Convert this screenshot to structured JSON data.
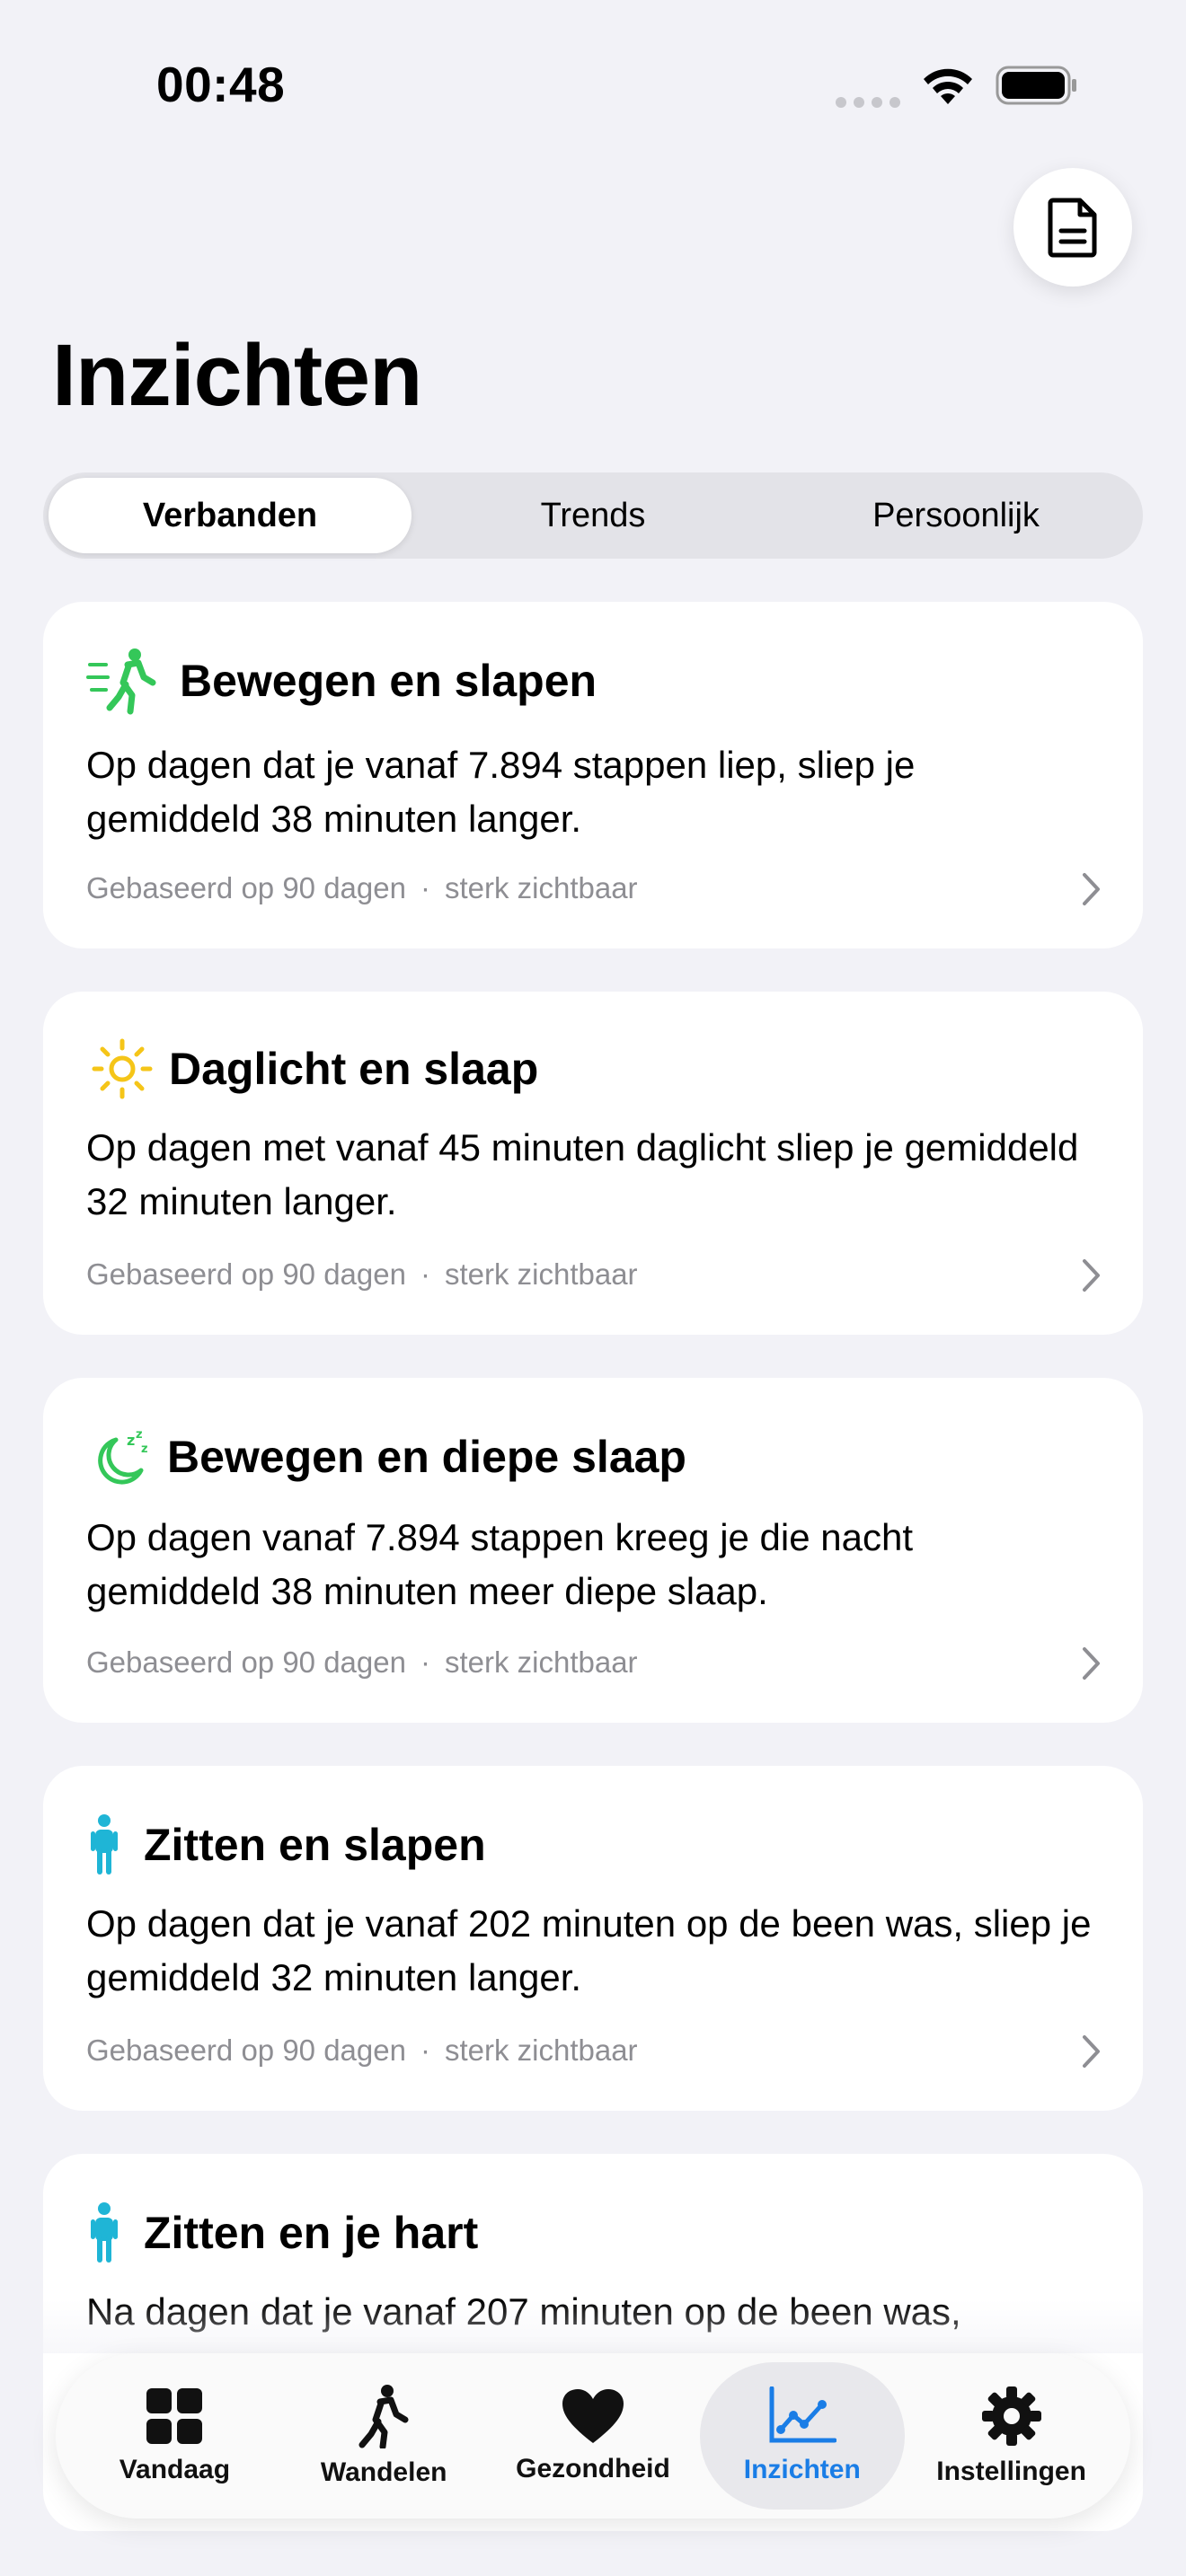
{
  "status": {
    "time": "00:48"
  },
  "title": "Inzichten",
  "segments": [
    {
      "label": "Verbanden"
    },
    {
      "label": "Trends"
    },
    {
      "label": "Persoonlijk"
    }
  ],
  "cards": [
    {
      "icon": "walking-motion-icon",
      "title": "Bewegen en slapen",
      "text": "Op dagen dat je vanaf 7.894 stappen liep, sliep je gemiddeld 38 minuten langer.",
      "basis": "Gebaseerd op 90 dagen",
      "strength": "sterk zichtbaar"
    },
    {
      "icon": "sun-icon",
      "title": "Daglicht en slaap",
      "text": "Op dagen met vanaf 45 minuten daglicht sliep je gemiddeld 32 minuten langer.",
      "basis": "Gebaseerd op 90 dagen",
      "strength": "sterk zichtbaar"
    },
    {
      "icon": "moon-zzz-icon",
      "title": "Bewegen en diepe slaap",
      "text": "Op dagen vanaf 7.894 stappen kreeg je die nacht gemiddeld 38 minuten meer diepe slaap.",
      "basis": "Gebaseerd op 90 dagen",
      "strength": "sterk zichtbaar"
    },
    {
      "icon": "standing-person-icon",
      "title": "Zitten en slapen",
      "text": "Op dagen dat je vanaf 202 minuten op de been was, sliep je gemiddeld 32 minuten langer.",
      "basis": "Gebaseerd op 90 dagen",
      "strength": "sterk zichtbaar"
    },
    {
      "icon": "standing-person-icon",
      "title": "Zitten en je hart",
      "text": "Na dagen dat je vanaf 207 minuten op de been was,",
      "basis": "",
      "strength": ""
    }
  ],
  "tabs": [
    {
      "label": "Vandaag",
      "icon": "grid-icon"
    },
    {
      "label": "Wandelen",
      "icon": "walking-icon"
    },
    {
      "label": "Gezondheid",
      "icon": "heart-icon"
    },
    {
      "label": "Inzichten",
      "icon": "chart-line-icon",
      "active": true
    },
    {
      "label": "Instellingen",
      "icon": "gear-icon"
    }
  ],
  "colors": {
    "accent": "#1a7de6",
    "green": "#34c759",
    "yellow": "#f5c518",
    "teal": "#1fb5d6",
    "secondary_text": "#8e8e93"
  }
}
